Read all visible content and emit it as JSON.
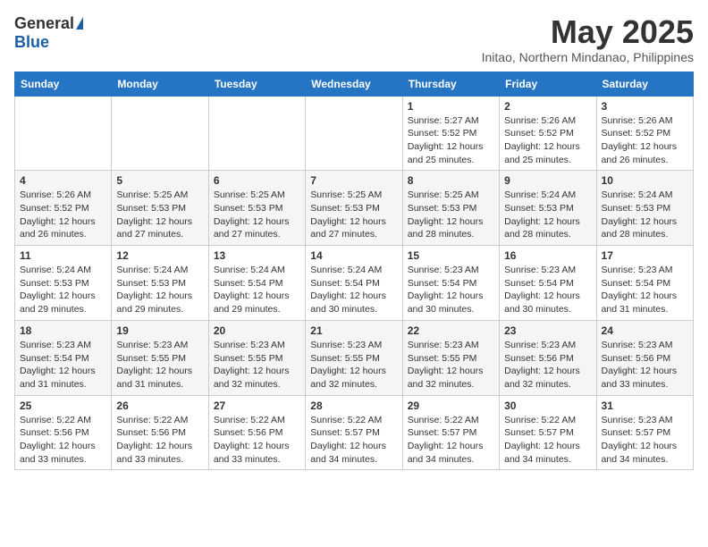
{
  "logo": {
    "general": "General",
    "blue": "Blue"
  },
  "header": {
    "month_year": "May 2025",
    "location": "Initao, Northern Mindanao, Philippines"
  },
  "days_of_week": [
    "Sunday",
    "Monday",
    "Tuesday",
    "Wednesday",
    "Thursday",
    "Friday",
    "Saturday"
  ],
  "weeks": [
    [
      {
        "day": "",
        "info": ""
      },
      {
        "day": "",
        "info": ""
      },
      {
        "day": "",
        "info": ""
      },
      {
        "day": "",
        "info": ""
      },
      {
        "day": "1",
        "info": "Sunrise: 5:27 AM\nSunset: 5:52 PM\nDaylight: 12 hours\nand 25 minutes."
      },
      {
        "day": "2",
        "info": "Sunrise: 5:26 AM\nSunset: 5:52 PM\nDaylight: 12 hours\nand 25 minutes."
      },
      {
        "day": "3",
        "info": "Sunrise: 5:26 AM\nSunset: 5:52 PM\nDaylight: 12 hours\nand 26 minutes."
      }
    ],
    [
      {
        "day": "4",
        "info": "Sunrise: 5:26 AM\nSunset: 5:52 PM\nDaylight: 12 hours\nand 26 minutes."
      },
      {
        "day": "5",
        "info": "Sunrise: 5:25 AM\nSunset: 5:53 PM\nDaylight: 12 hours\nand 27 minutes."
      },
      {
        "day": "6",
        "info": "Sunrise: 5:25 AM\nSunset: 5:53 PM\nDaylight: 12 hours\nand 27 minutes."
      },
      {
        "day": "7",
        "info": "Sunrise: 5:25 AM\nSunset: 5:53 PM\nDaylight: 12 hours\nand 27 minutes."
      },
      {
        "day": "8",
        "info": "Sunrise: 5:25 AM\nSunset: 5:53 PM\nDaylight: 12 hours\nand 28 minutes."
      },
      {
        "day": "9",
        "info": "Sunrise: 5:24 AM\nSunset: 5:53 PM\nDaylight: 12 hours\nand 28 minutes."
      },
      {
        "day": "10",
        "info": "Sunrise: 5:24 AM\nSunset: 5:53 PM\nDaylight: 12 hours\nand 28 minutes."
      }
    ],
    [
      {
        "day": "11",
        "info": "Sunrise: 5:24 AM\nSunset: 5:53 PM\nDaylight: 12 hours\nand 29 minutes."
      },
      {
        "day": "12",
        "info": "Sunrise: 5:24 AM\nSunset: 5:53 PM\nDaylight: 12 hours\nand 29 minutes."
      },
      {
        "day": "13",
        "info": "Sunrise: 5:24 AM\nSunset: 5:54 PM\nDaylight: 12 hours\nand 29 minutes."
      },
      {
        "day": "14",
        "info": "Sunrise: 5:24 AM\nSunset: 5:54 PM\nDaylight: 12 hours\nand 30 minutes."
      },
      {
        "day": "15",
        "info": "Sunrise: 5:23 AM\nSunset: 5:54 PM\nDaylight: 12 hours\nand 30 minutes."
      },
      {
        "day": "16",
        "info": "Sunrise: 5:23 AM\nSunset: 5:54 PM\nDaylight: 12 hours\nand 30 minutes."
      },
      {
        "day": "17",
        "info": "Sunrise: 5:23 AM\nSunset: 5:54 PM\nDaylight: 12 hours\nand 31 minutes."
      }
    ],
    [
      {
        "day": "18",
        "info": "Sunrise: 5:23 AM\nSunset: 5:54 PM\nDaylight: 12 hours\nand 31 minutes."
      },
      {
        "day": "19",
        "info": "Sunrise: 5:23 AM\nSunset: 5:55 PM\nDaylight: 12 hours\nand 31 minutes."
      },
      {
        "day": "20",
        "info": "Sunrise: 5:23 AM\nSunset: 5:55 PM\nDaylight: 12 hours\nand 32 minutes."
      },
      {
        "day": "21",
        "info": "Sunrise: 5:23 AM\nSunset: 5:55 PM\nDaylight: 12 hours\nand 32 minutes."
      },
      {
        "day": "22",
        "info": "Sunrise: 5:23 AM\nSunset: 5:55 PM\nDaylight: 12 hours\nand 32 minutes."
      },
      {
        "day": "23",
        "info": "Sunrise: 5:23 AM\nSunset: 5:56 PM\nDaylight: 12 hours\nand 32 minutes."
      },
      {
        "day": "24",
        "info": "Sunrise: 5:23 AM\nSunset: 5:56 PM\nDaylight: 12 hours\nand 33 minutes."
      }
    ],
    [
      {
        "day": "25",
        "info": "Sunrise: 5:22 AM\nSunset: 5:56 PM\nDaylight: 12 hours\nand 33 minutes."
      },
      {
        "day": "26",
        "info": "Sunrise: 5:22 AM\nSunset: 5:56 PM\nDaylight: 12 hours\nand 33 minutes."
      },
      {
        "day": "27",
        "info": "Sunrise: 5:22 AM\nSunset: 5:56 PM\nDaylight: 12 hours\nand 33 minutes."
      },
      {
        "day": "28",
        "info": "Sunrise: 5:22 AM\nSunset: 5:57 PM\nDaylight: 12 hours\nand 34 minutes."
      },
      {
        "day": "29",
        "info": "Sunrise: 5:22 AM\nSunset: 5:57 PM\nDaylight: 12 hours\nand 34 minutes."
      },
      {
        "day": "30",
        "info": "Sunrise: 5:22 AM\nSunset: 5:57 PM\nDaylight: 12 hours\nand 34 minutes."
      },
      {
        "day": "31",
        "info": "Sunrise: 5:23 AM\nSunset: 5:57 PM\nDaylight: 12 hours\nand 34 minutes."
      }
    ]
  ]
}
